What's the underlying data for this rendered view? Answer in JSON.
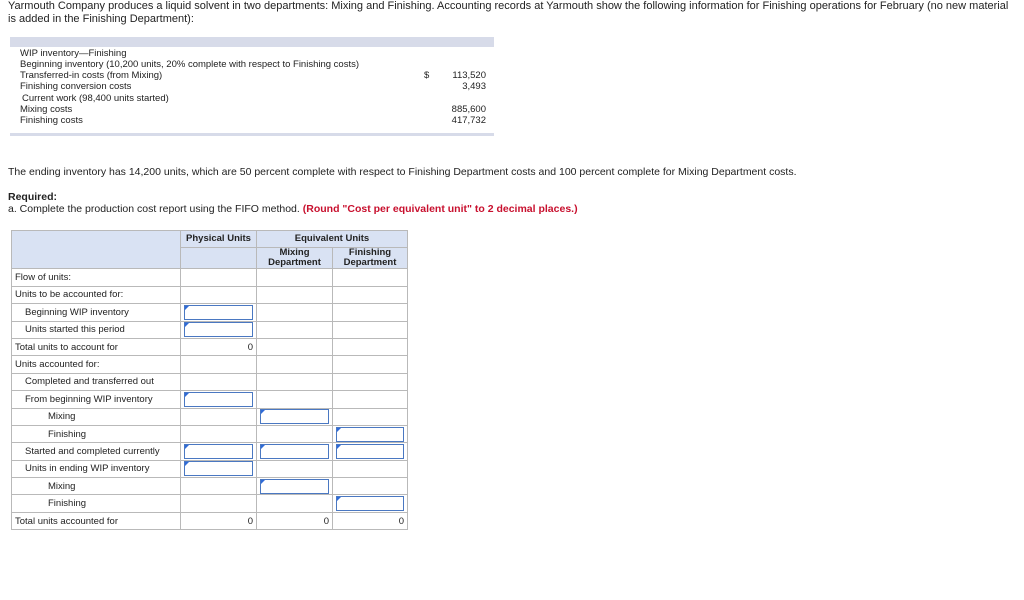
{
  "intro": "Yarmouth Company produces a liquid solvent in two departments: Mixing and Finishing. Accounting records at Yarmouth show the following information for Finishing operations for February (no new material is added in the Finishing Department):",
  "info": {
    "rows": [
      {
        "label": "WIP inventory—Finishing",
        "currency": "",
        "amount": ""
      },
      {
        "label": "Beginning inventory (10,200 units, 20% complete with respect to Finishing costs)",
        "currency": "",
        "amount": ""
      },
      {
        "label": "Transferred-in costs (from Mixing)",
        "currency": "$",
        "amount": "113,520"
      },
      {
        "label": "Finishing conversion costs",
        "currency": "",
        "amount": "3,493"
      },
      {
        "label": "Current work (98,400 units started)",
        "currency": "",
        "amount": ""
      },
      {
        "label": "Mixing costs",
        "currency": "",
        "amount": "885,600"
      },
      {
        "label": "Finishing costs",
        "currency": "",
        "amount": "417,732"
      }
    ]
  },
  "ending_text": "The ending inventory has 14,200 units, which are 50 percent complete with respect to Finishing Department costs and 100 percent complete for Mixing Department costs.",
  "required_label": "Required:",
  "instruction": "a. Complete the production cost report using the FIFO method.",
  "instruction_note": "(Round \"Cost per equivalent unit\" to 2 decimal places.)",
  "table": {
    "headers": {
      "physical": "Physical Units",
      "equivalent": "Equivalent Units",
      "mixing": "Mixing Department",
      "finishing": "Finishing Department"
    },
    "rows": [
      {
        "label": "Flow of units:",
        "indent": 0,
        "cells": [
          "",
          "",
          ""
        ]
      },
      {
        "label": "Units to be accounted for:",
        "indent": 0,
        "cells": [
          "",
          "",
          ""
        ]
      },
      {
        "label": "Beginning WIP inventory",
        "indent": 1,
        "cells": [
          "input",
          "",
          ""
        ]
      },
      {
        "label": "Units started this period",
        "indent": 1,
        "cells": [
          "input",
          "",
          ""
        ]
      },
      {
        "label": "Total units to account for",
        "indent": 0,
        "cells": [
          "0",
          "",
          ""
        ]
      },
      {
        "label": "Units accounted for:",
        "indent": 0,
        "cells": [
          "",
          "",
          ""
        ]
      },
      {
        "label": "Completed and transferred out",
        "indent": 1,
        "cells": [
          "",
          "",
          ""
        ]
      },
      {
        "label": "From beginning WIP inventory",
        "indent": 1,
        "cells": [
          "input",
          "",
          ""
        ]
      },
      {
        "label": "Mixing",
        "indent": 2,
        "cells": [
          "",
          "input",
          ""
        ]
      },
      {
        "label": "Finishing",
        "indent": 2,
        "cells": [
          "",
          "",
          "input"
        ]
      },
      {
        "label": "Started and completed currently",
        "indent": 1,
        "cells": [
          "input",
          "input",
          "input"
        ]
      },
      {
        "label": "Units in ending WIP inventory",
        "indent": 1,
        "cells": [
          "input",
          "",
          ""
        ]
      },
      {
        "label": "Mixing",
        "indent": 2,
        "cells": [
          "",
          "input",
          ""
        ]
      },
      {
        "label": "Finishing",
        "indent": 2,
        "cells": [
          "",
          "",
          "input"
        ]
      },
      {
        "label": "Total units accounted for",
        "indent": 0,
        "cells": [
          "0",
          "0",
          "0"
        ]
      }
    ]
  }
}
